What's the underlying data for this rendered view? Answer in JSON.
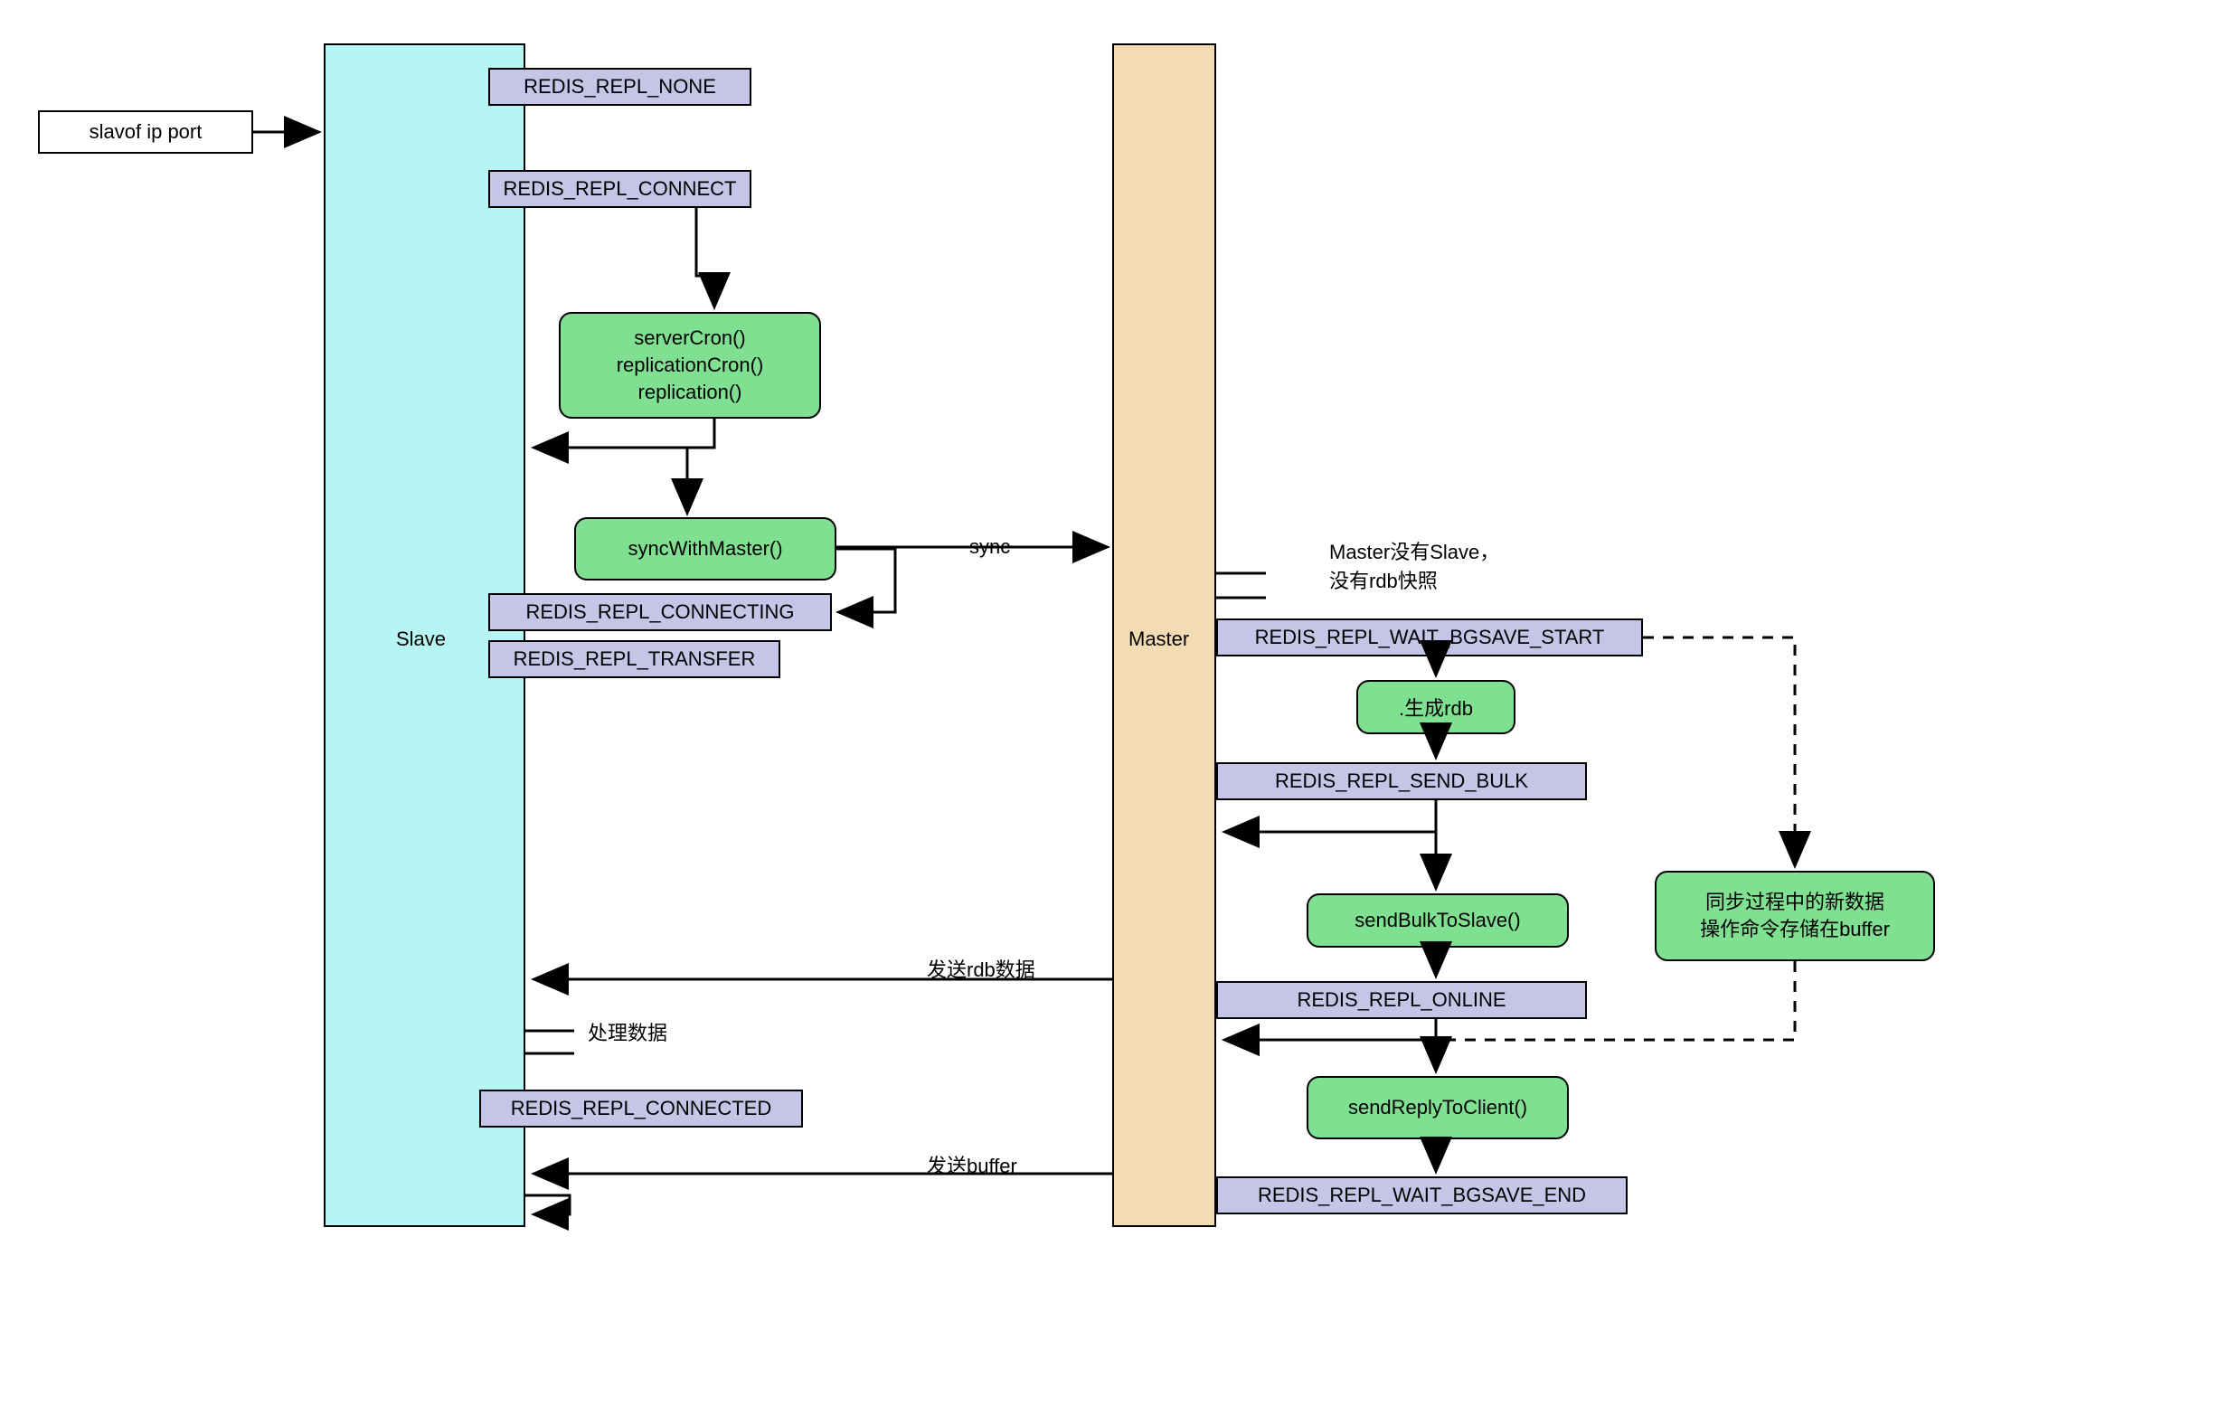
{
  "cmd": "slavof ip port",
  "slave_title": "Slave",
  "master_title": "Master",
  "states": {
    "none": "REDIS_REPL_NONE",
    "connect": "REDIS_REPL_CONNECT",
    "connecting": "REDIS_REPL_CONNECTING",
    "transfer": "REDIS_REPL_TRANSFER",
    "connected": "REDIS_REPL_CONNECTED",
    "wait_start": "REDIS_REPL_WAIT_BGSAVE_START",
    "send_bulk": "REDIS_REPL_SEND_BULK",
    "online": "REDIS_REPL_ONLINE",
    "wait_end": "REDIS_REPL_WAIT_BGSAVE_END"
  },
  "procs": {
    "cron1": "serverCron()",
    "cron2": "replicationCron()",
    "cron3": "replication()",
    "sync": "syncWithMaster()",
    "gen_rdb": ".生成rdb",
    "send_bulk": "sendBulkToSlave()",
    "send_reply": "sendReplyToClient()",
    "buffer1": "同步过程中的新数据",
    "buffer2": "操作命令存储在buffer"
  },
  "labels": {
    "sync": "sync",
    "no_slave1": "Master没有Slave，",
    "no_slave2": "没有rdb快照",
    "send_rdb": "发送rdb数据",
    "process": "处理数据",
    "send_buffer": "发送buffer"
  }
}
